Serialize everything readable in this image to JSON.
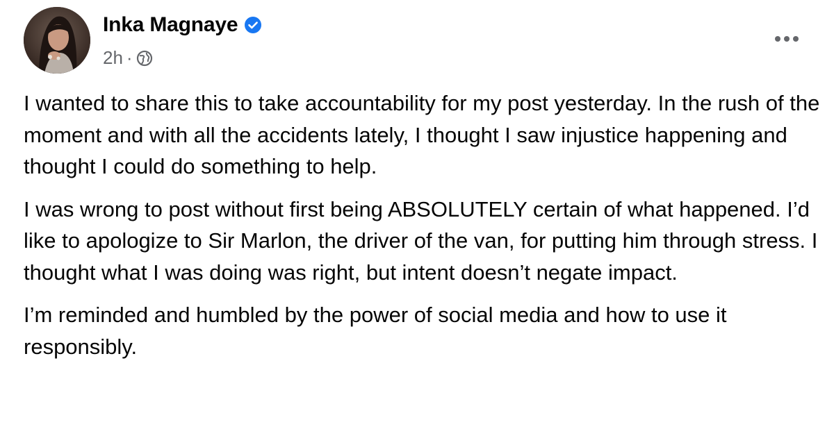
{
  "post": {
    "author": {
      "name": "Inka Magnaye",
      "verified": true,
      "avatar": "avatar"
    },
    "timestamp": "2h",
    "separator": "·",
    "audience_icon": "globe-icon",
    "more_icon": "more-options-icon",
    "paragraphs": [
      "I wanted to share this to take accountability for my post yesterday. In the rush of the moment and with all the accidents lately, I thought I saw injustice happening and thought I could do something to help.",
      "I was wrong to post without first being ABSOLUTELY certain of what happened. I’d like to apologize to Sir Marlon, the driver of the van, for putting him through stress. I thought what I was doing was right, but intent doesn’t negate impact.",
      "I’m reminded and humbled by the power of social media and how to use it responsibly."
    ]
  },
  "colors": {
    "text": "#050505",
    "secondary_text": "#65676b",
    "verified_blue": "#1877f2",
    "background": "#ffffff"
  }
}
